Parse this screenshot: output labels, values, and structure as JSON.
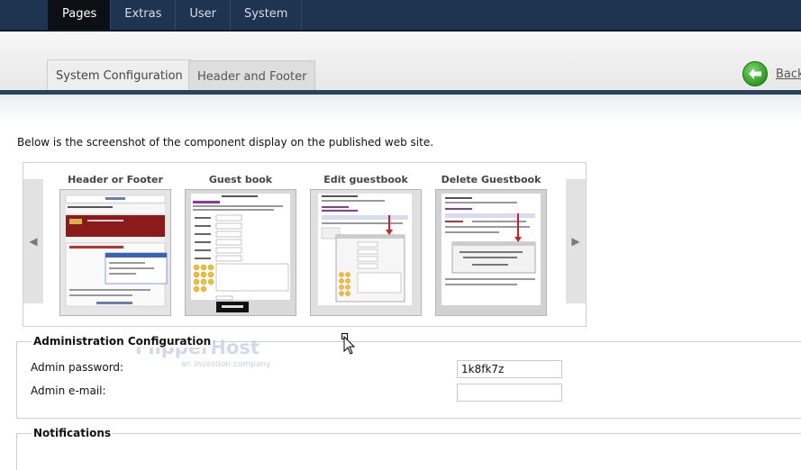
{
  "nav": {
    "items": [
      {
        "label": "Pages",
        "active": true
      },
      {
        "label": "Extras",
        "active": false
      },
      {
        "label": "User",
        "active": false
      },
      {
        "label": "System",
        "active": false
      }
    ]
  },
  "tabs": [
    {
      "label": "System Configuration",
      "active": true
    },
    {
      "label": "Header and Footer",
      "active": false
    }
  ],
  "back": {
    "label": "Back",
    "icon": "arrow-left-icon",
    "color": "#2e9a1f"
  },
  "intro": {
    "text": "Below is the screenshot of the component display on the published web site."
  },
  "carousel": {
    "items": [
      {
        "title": "Header or Footer"
      },
      {
        "title": "Guest book"
      },
      {
        "title": "Edit guestbook"
      },
      {
        "title": "Delete Guestbook"
      }
    ]
  },
  "admin": {
    "legend": "Administration Configuration",
    "password_label": "Admin password:",
    "password_value": "1k8fk7z",
    "email_label": "Admin e-mail:",
    "email_value": ""
  },
  "notifications": {
    "legend": "Notifications"
  },
  "watermark": {
    "brand": "FlipperHost",
    "tagline": "an investion company"
  },
  "colors": {
    "nav_bg": "#1f3450",
    "nav_active": "#0c0f14",
    "band_line": "#2a4262"
  }
}
